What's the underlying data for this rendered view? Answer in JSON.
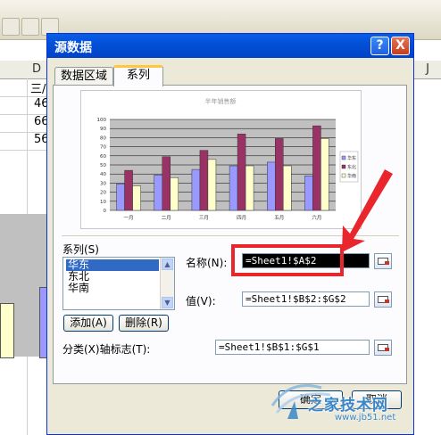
{
  "spreadsheet": {
    "column_header_d": "D",
    "column_header_j": "J",
    "cells": [
      "三/",
      "46",
      "66",
      "56"
    ]
  },
  "dialog": {
    "title": "源数据",
    "help_label": "?",
    "close_label": "X",
    "tabs": [
      {
        "label": "数据区域",
        "active": false
      },
      {
        "label": "系列",
        "active": true
      }
    ],
    "chart_preview": {
      "title": "半年销售额"
    },
    "series_section": {
      "label": "系列(S)",
      "items": [
        "华东",
        "东北",
        "华南"
      ],
      "selected": "华东",
      "add_label": "添加(A)",
      "delete_label": "删除(R)"
    },
    "name_label": "名称(N):",
    "name_value": "=Sheet1!$A$2",
    "value_label": "值(V):",
    "value_value": "=Sheet1!$B$2:$G$2",
    "category_label": "分类(X)轴标志(T):",
    "category_value": "=Sheet1!$B$1:$G$1",
    "ok_label": "确定",
    "cancel_label": "取消"
  },
  "chart_data": {
    "type": "bar",
    "title": "半年销售额",
    "categories": [
      "一月",
      "二月",
      "三月",
      "四月",
      "五月",
      "六月"
    ],
    "series": [
      {
        "name": "华东",
        "values": [
          29,
          39,
          45,
          49,
          53,
          38
        ],
        "color": "#9999ff"
      },
      {
        "name": "东北",
        "values": [
          44,
          59,
          66,
          84,
          79,
          93
        ],
        "color": "#993366"
      },
      {
        "name": "华南",
        "values": [
          27,
          36,
          56,
          49,
          49,
          79
        ],
        "color": "#ffffcc"
      }
    ],
    "ylim": [
      0,
      100
    ],
    "yticks": [
      0,
      10,
      20,
      30,
      40,
      50,
      60,
      70,
      80,
      90,
      100
    ],
    "legend_position": "right",
    "grid": true
  },
  "watermark": {
    "text": "www.jb51.net",
    "brand": "之家技术网"
  },
  "colors": {
    "dialog_bg": "#ece9d8",
    "titlebar": "#0350d6",
    "highlight": "#e8262b",
    "selection": "#316ac5"
  }
}
